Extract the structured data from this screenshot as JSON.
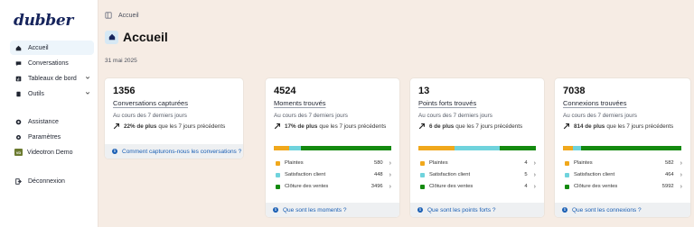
{
  "sidebar": {
    "logo": "dubber",
    "items": [
      {
        "label": "Accueil",
        "icon": "home-icon"
      },
      {
        "label": "Conversations",
        "icon": "chat-icon"
      },
      {
        "label": "Tableaux de bord",
        "icon": "dashboard-icon"
      },
      {
        "label": "Outils",
        "icon": "tools-icon"
      },
      {
        "label": "Assistance",
        "icon": "assistance-icon"
      },
      {
        "label": "Paramètres",
        "icon": "gear-icon"
      },
      {
        "label": "Videotron Demo",
        "icon": "vd-badge",
        "badge": "VD"
      },
      {
        "label": "Déconnexion",
        "icon": "logout-icon"
      }
    ]
  },
  "breadcrumb": "Accueil",
  "page_title": "Accueil",
  "date": "31 mai 2025",
  "colors": {
    "plaintes": "#f0a81c",
    "satisfaction": "#6fd3dc",
    "cloture": "#148a0f",
    "link": "#1a5fb4",
    "brand": "#16245c"
  },
  "cards": [
    {
      "number": "1356",
      "label": "Conversations capturées",
      "period": "Au cours des 7 derniers jours",
      "trend_bold": "22% de plus",
      "trend_rest": "que les 7 jours précédents",
      "footer": "Comment capturons-nous les conversations ?"
    },
    {
      "number": "4524",
      "label": "Moments trouvés",
      "period": "Au cours des 7 derniers jours",
      "trend_bold": "17% de plus",
      "trend_rest": "que les 7 jours précédents",
      "footer": "Que sont les moments ?",
      "legend": [
        {
          "label": "Plaintes",
          "value": "580"
        },
        {
          "label": "Satisfaction client",
          "value": "448"
        },
        {
          "label": "Clôture des ventes",
          "value": "3496"
        }
      ]
    },
    {
      "number": "13",
      "label": "Points forts trouvés",
      "period": "Au cours des 7 derniers jours",
      "trend_bold": "6 de plus",
      "trend_rest": "que les 7 jours précédents",
      "footer": "Que sont les points forts ?",
      "legend": [
        {
          "label": "Plaintes",
          "value": "4"
        },
        {
          "label": "Satisfaction client",
          "value": "5"
        },
        {
          "label": "Clôture des ventes",
          "value": "4"
        }
      ]
    },
    {
      "number": "7038",
      "label": "Connexions trouvées",
      "period": "Au cours des 7 derniers jours",
      "trend_bold": "814 de plus",
      "trend_rest": "que les 7 jours précédents",
      "footer": "Que sont les connexions ?",
      "legend": [
        {
          "label": "Plaintes",
          "value": "582"
        },
        {
          "label": "Satisfaction client",
          "value": "464"
        },
        {
          "label": "Clôture des ventes",
          "value": "5992"
        }
      ]
    }
  ]
}
